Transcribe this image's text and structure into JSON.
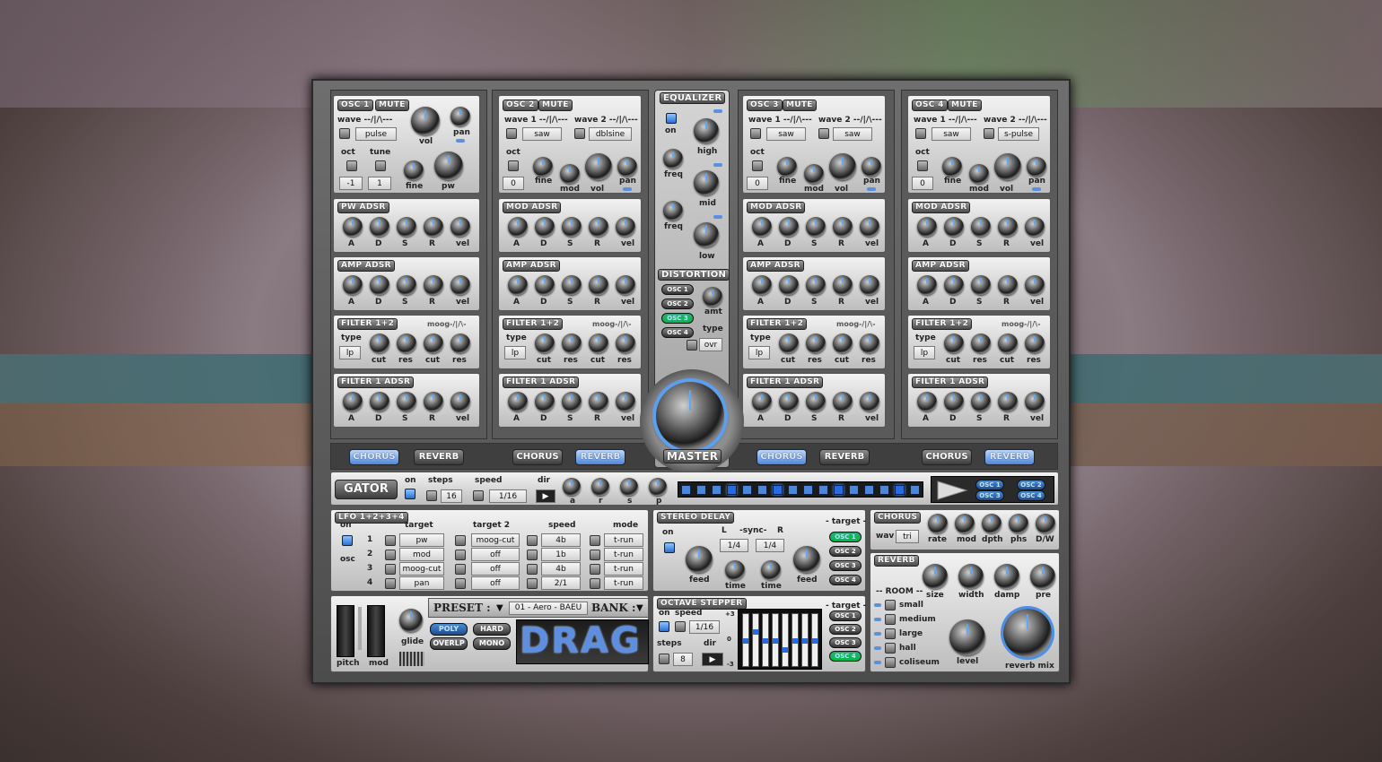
{
  "osc1": {
    "title": "OSC 1",
    "mute": "MUTE",
    "wave_label": "wave --/|/\\---",
    "wave": "pulse",
    "oct": "oct",
    "tune": "tune",
    "oct_val": "-1",
    "tune_val": "1",
    "vol": "vol",
    "pan": "pan",
    "fine": "fine",
    "pw": "pw"
  },
  "osc2": {
    "title": "OSC 2",
    "mute": "MUTE",
    "wave1_label": "wave 1 --/|/\\---",
    "wave2_label": "wave 2 --/|/\\---",
    "wave1": "saw",
    "wave2": "dblsine",
    "oct": "oct",
    "oct_val": "0",
    "fine": "fine",
    "mod": "mod",
    "vol": "vol",
    "pan": "pan"
  },
  "osc3": {
    "title": "OSC 3",
    "mute": "MUTE",
    "wave1_label": "wave 1 --/|/\\---",
    "wave2_label": "wave 2 --/|/\\---",
    "wave1": "saw",
    "wave2": "saw",
    "oct": "oct",
    "oct_val": "0",
    "fine": "fine",
    "mod": "mod",
    "vol": "vol",
    "pan": "pan"
  },
  "osc4": {
    "title": "OSC 4",
    "mute": "MUTE",
    "wave1_label": "wave 1 --/|/\\---",
    "wave2_label": "wave 2 --/|/\\---",
    "wave1": "saw",
    "wave2": "s-pulse",
    "oct": "oct",
    "oct_val": "0",
    "fine": "fine",
    "mod": "mod",
    "vol": "vol",
    "pan": "pan"
  },
  "adsr_labels": [
    "A",
    "D",
    "S",
    "R",
    "vel"
  ],
  "col_titles": {
    "c1": [
      "PW ADSR",
      "AMP ADSR",
      "FILTER 1+2",
      "FILTER 1 ADSR"
    ],
    "c2": [
      "MOD ADSR",
      "AMP ADSR",
      "FILTER 1+2",
      "FILTER 1 ADSR"
    ],
    "c3": [
      "MOD ADSR",
      "AMP ADSR",
      "FILTER 1+2",
      "FILTER 1 ADSR"
    ],
    "c4": [
      "MOD ADSR",
      "AMP ADSR",
      "FILTER 1+2",
      "FILTER 1 ADSR"
    ]
  },
  "filter": {
    "moog": "moog-/|/\\-",
    "type": "type",
    "type_val": "lp",
    "cut": "cut",
    "res": "res"
  },
  "fx_tabs": {
    "chorus": "CHORUS",
    "reverb": "REVERB"
  },
  "eq": {
    "title": "EQUALIZER",
    "on": "on",
    "high": "high",
    "freq": "freq",
    "mid": "mid",
    "low": "low"
  },
  "distortion": {
    "title": "DISTORTION",
    "osc": [
      "OSC 1",
      "OSC 2",
      "OSC 3",
      "OSC 4"
    ],
    "amt": "amt",
    "type": "type",
    "type_val": "ovr"
  },
  "master": "MASTER",
  "gator": {
    "title": "GATOR",
    "on": "on",
    "steps": "steps",
    "steps_val": "16",
    "speed": "speed",
    "speed_val": "1/16",
    "dir": "dir",
    "knobs": [
      "a",
      "r",
      "s",
      "p"
    ],
    "osc": [
      "OSC 1",
      "OSC 2",
      "OSC 3",
      "OSC 4"
    ]
  },
  "lfo": {
    "title": "LFO 1+2+3+4",
    "on": "on",
    "osc": "osc",
    "target": "target",
    "target2": "target 2",
    "speed": "speed",
    "mode": "mode",
    "rows": [
      {
        "n": "1",
        "t": "pw",
        "t2": "moog-cut",
        "s": "4b",
        "m": "t-run"
      },
      {
        "n": "2",
        "t": "mod",
        "t2": "off",
        "s": "1b",
        "m": "t-run"
      },
      {
        "n": "3",
        "t": "moog-cut",
        "t2": "off",
        "s": "4b",
        "m": "t-run"
      },
      {
        "n": "4",
        "t": "pan",
        "t2": "off",
        "s": "2/1",
        "m": "t-run"
      }
    ]
  },
  "delay": {
    "title": "STEREO DELAY",
    "target": "- target -",
    "on": "on",
    "L": "L",
    "sync": "-sync-",
    "R": "R",
    "l_val": "1/4",
    "r_val": "1/4",
    "feed": "feed",
    "time": "time",
    "osc": [
      "OSC 1",
      "OSC 2",
      "OSC 3",
      "OSC 4"
    ]
  },
  "chorus": {
    "title": "CHORUS",
    "wav": "wav",
    "wav_val": "tri",
    "knobs": [
      "rate",
      "mod",
      "dpth",
      "phs",
      "D/W"
    ]
  },
  "reverb": {
    "title": "REVERB",
    "room": "-- ROOM --",
    "rooms": [
      "small",
      "medium",
      "large",
      "hall",
      "coliseum"
    ],
    "knobs": [
      "size",
      "width",
      "damp",
      "pre"
    ],
    "level": "level",
    "mix": "reverb mix"
  },
  "stepper": {
    "title": "OCTAVE STEPPER",
    "target": "- target -",
    "on": "on",
    "speed": "speed",
    "speed_val": "1/16",
    "steps": "steps",
    "steps_val": "8",
    "dir": "dir",
    "scale": [
      "+3",
      "0",
      "-3"
    ],
    "osc": [
      "OSC 1",
      "OSC 2",
      "OSC 3",
      "OSC 4"
    ]
  },
  "bottom": {
    "pitch": "pitch",
    "mod": "mod",
    "glide": "glide",
    "preset_label": "PRESET :",
    "preset": "01 - Aero - BAEU",
    "bank": "BANK :",
    "modes": [
      "POLY",
      "HARD",
      "OVERLP",
      "MONO"
    ],
    "logo": "DRAG"
  }
}
